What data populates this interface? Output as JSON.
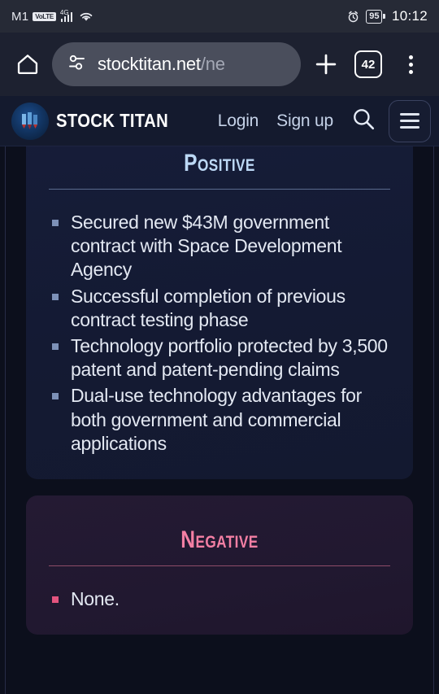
{
  "status_bar": {
    "carrier": "M1",
    "volte_badge": "VoLTE",
    "network_type": "4G",
    "signal_icon": "signal-bars-icon",
    "wifi_icon": "wifi-icon",
    "alarm_icon": "alarm-clock-icon",
    "battery_percent": "95",
    "time": "10:12"
  },
  "browser": {
    "home_icon": "home-icon",
    "page_info_icon": "tune-sliders-icon",
    "url_domain": "stocktitan.net",
    "url_path": "/ne",
    "new_tab_icon": "plus-icon",
    "tab_count": "42",
    "overflow_icon": "kebab-menu-icon"
  },
  "site_header": {
    "logo_icon": "stock-titan-logo-icon",
    "brand": "STOCK TITAN",
    "login_label": "Login",
    "signup_label": "Sign up",
    "search_icon": "search-icon",
    "menu_icon": "hamburger-menu-icon"
  },
  "content": {
    "positive": {
      "title": "Positive",
      "accent_color": "#bcd8f5",
      "bullets": [
        "Secured new $43M government contract with Space Development Agency",
        "Successful completion of previous contract testing phase",
        "Technology portfolio protected by 3,500 patent and patent-pending claims",
        "Dual-use technology advantages for both government and commercial applications"
      ]
    },
    "negative": {
      "title": "Negative",
      "accent_color": "#f47fa4",
      "bullets": [
        "None."
      ]
    }
  }
}
